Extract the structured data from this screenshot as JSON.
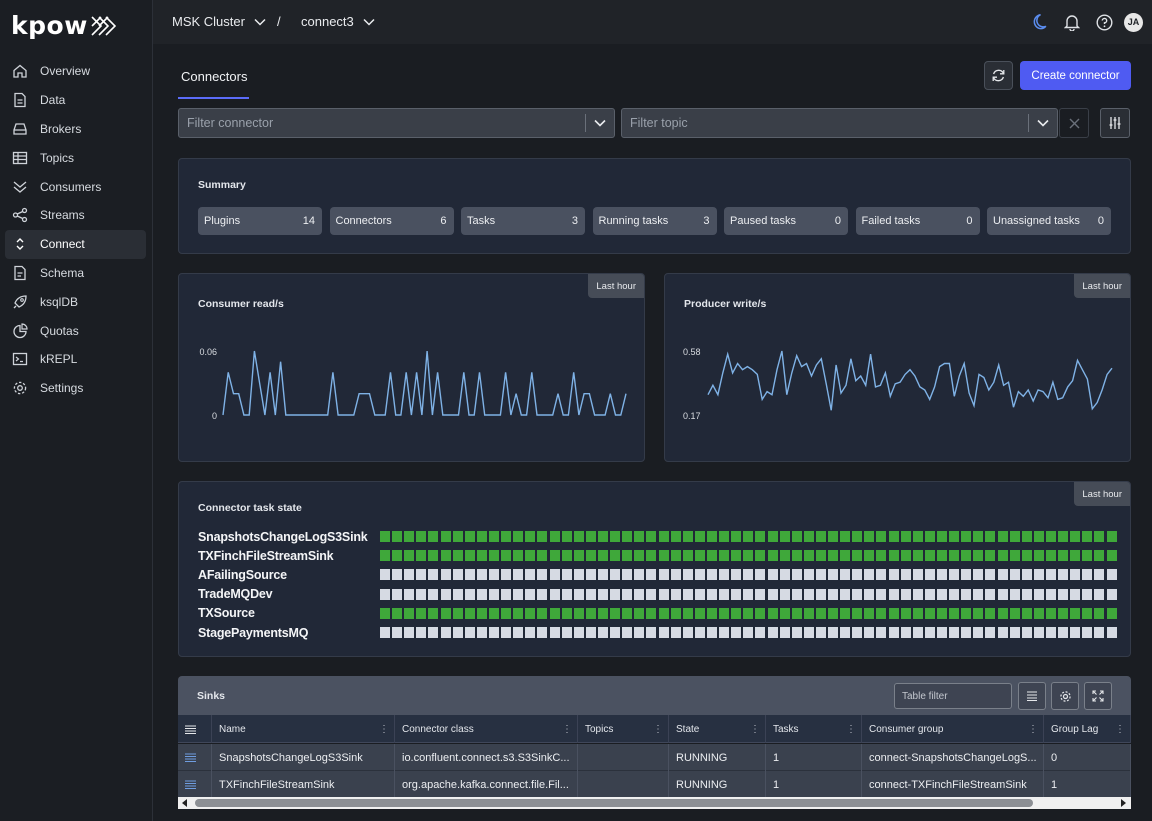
{
  "app": {
    "logo_text": "kpow"
  },
  "sidebar": {
    "items": [
      {
        "label": "Overview",
        "icon": "home-icon"
      },
      {
        "label": "Data",
        "icon": "document-icon"
      },
      {
        "label": "Brokers",
        "icon": "server-icon"
      },
      {
        "label": "Topics",
        "icon": "table-icon"
      },
      {
        "label": "Consumers",
        "icon": "consumers-icon"
      },
      {
        "label": "Streams",
        "icon": "share-icon"
      },
      {
        "label": "Connect",
        "icon": "connect-icon",
        "active": true
      },
      {
        "label": "Schema",
        "icon": "schema-icon"
      },
      {
        "label": "ksqlDB",
        "icon": "rocket-icon"
      },
      {
        "label": "Quotas",
        "icon": "pie-icon"
      },
      {
        "label": "kREPL",
        "icon": "terminal-icon"
      },
      {
        "label": "Settings",
        "icon": "gear-icon"
      }
    ]
  },
  "header": {
    "cluster": "MSK Cluster",
    "separator": "/",
    "connect_cluster": "connect3",
    "avatar_initials": "JA"
  },
  "main": {
    "tab": "Connectors",
    "create_button": "Create connector",
    "filter_connector_placeholder": "Filter connector",
    "filter_topic_placeholder": "Filter topic"
  },
  "summary": {
    "title": "Summary",
    "chips": [
      {
        "label": "Plugins",
        "value": "14"
      },
      {
        "label": "Connectors",
        "value": "6"
      },
      {
        "label": "Tasks",
        "value": "3"
      },
      {
        "label": "Running tasks",
        "value": "3"
      },
      {
        "label": "Paused tasks",
        "value": "0"
      },
      {
        "label": "Failed tasks",
        "value": "0"
      },
      {
        "label": "Unassigned tasks",
        "value": "0"
      }
    ]
  },
  "charts": {
    "last_hour_label": "Last hour",
    "line_color": "#7fb2e6"
  },
  "chart_data": [
    {
      "type": "line",
      "title": "Consumer read/s",
      "y_ticks": [
        "0.06",
        "0"
      ],
      "ylim": [
        0,
        0.06
      ],
      "values": [
        0,
        0.04,
        0.02,
        0.02,
        0,
        0,
        0.06,
        0.03,
        0,
        0.04,
        0,
        0.05,
        0,
        0,
        0,
        0,
        0,
        0,
        0,
        0,
        0,
        0.04,
        0,
        0,
        0,
        0,
        0.02,
        0.02,
        0.02,
        0,
        0,
        0,
        0.04,
        0,
        0,
        0.04,
        0,
        0.04,
        0,
        0.06,
        0,
        0.04,
        0,
        0,
        0,
        0,
        0.04,
        0,
        0,
        0.04,
        0,
        0,
        0,
        0,
        0.04,
        0,
        0.02,
        0,
        0,
        0.04,
        0,
        0,
        0,
        0,
        0.02,
        0,
        0,
        0.04,
        0,
        0.02,
        0.02,
        0,
        0,
        0,
        0.02,
        0,
        0,
        0.02
      ]
    },
    {
      "type": "line",
      "title": "Producer write/s",
      "y_ticks": [
        "0.58",
        "0.17"
      ],
      "ylim": [
        0.17,
        0.58
      ],
      "values": [
        0.3,
        0.36,
        0.3,
        0.44,
        0.56,
        0.44,
        0.5,
        0.46,
        0.48,
        0.46,
        0.43,
        0.27,
        0.32,
        0.3,
        0.46,
        0.58,
        0.3,
        0.44,
        0.55,
        0.48,
        0.5,
        0.42,
        0.49,
        0.53,
        0.37,
        0.2,
        0.49,
        0.31,
        0.36,
        0.53,
        0.39,
        0.42,
        0.36,
        0.56,
        0.35,
        0.36,
        0.44,
        0.29,
        0.37,
        0.38,
        0.43,
        0.46,
        0.42,
        0.35,
        0.33,
        0.27,
        0.35,
        0.48,
        0.5,
        0.5,
        0.29,
        0.42,
        0.5,
        0.31,
        0.23,
        0.43,
        0.41,
        0.33,
        0.38,
        0.49,
        0.36,
        0.38,
        0.22,
        0.32,
        0.29,
        0.33,
        0.26,
        0.33,
        0.32,
        0.28,
        0.38,
        0.27,
        0.28,
        0.35,
        0.39,
        0.52,
        0.46,
        0.4,
        0.21,
        0.25,
        0.33,
        0.43,
        0.47
      ]
    }
  ],
  "task_state": {
    "title": "Connector task state",
    "on_color": "#3fa83a",
    "off_color": "#d6dae3",
    "rows": [
      {
        "name": "SnapshotsChangeLogS3Sink",
        "state": "on",
        "cells": 61
      },
      {
        "name": "TXFinchFileStreamSink",
        "state": "on",
        "cells": 61
      },
      {
        "name": "AFailingSource",
        "state": "off",
        "cells": 61
      },
      {
        "name": "TradeMQDev",
        "state": "off",
        "cells": 61
      },
      {
        "name": "TXSource",
        "state": "on",
        "cells": 61
      },
      {
        "name": "StagePaymentsMQ",
        "state": "off",
        "cells": 61
      }
    ]
  },
  "sinks": {
    "title": "Sinks",
    "filter_placeholder": "Table filter",
    "columns": [
      "Name",
      "Connector class",
      "Topics",
      "State",
      "Tasks",
      "Consumer group",
      "Group Lag"
    ],
    "rows": [
      [
        "SnapshotsChangeLogS3Sink",
        "io.confluent.connect.s3.S3SinkC...",
        "",
        "RUNNING",
        "1",
        "connect-SnapshotsChangeLogS...",
        "0"
      ],
      [
        "TXFinchFileStreamSink",
        "org.apache.kafka.connect.file.Fil...",
        "",
        "RUNNING",
        "1",
        "connect-TXFinchFileStreamSink",
        "1"
      ]
    ]
  }
}
